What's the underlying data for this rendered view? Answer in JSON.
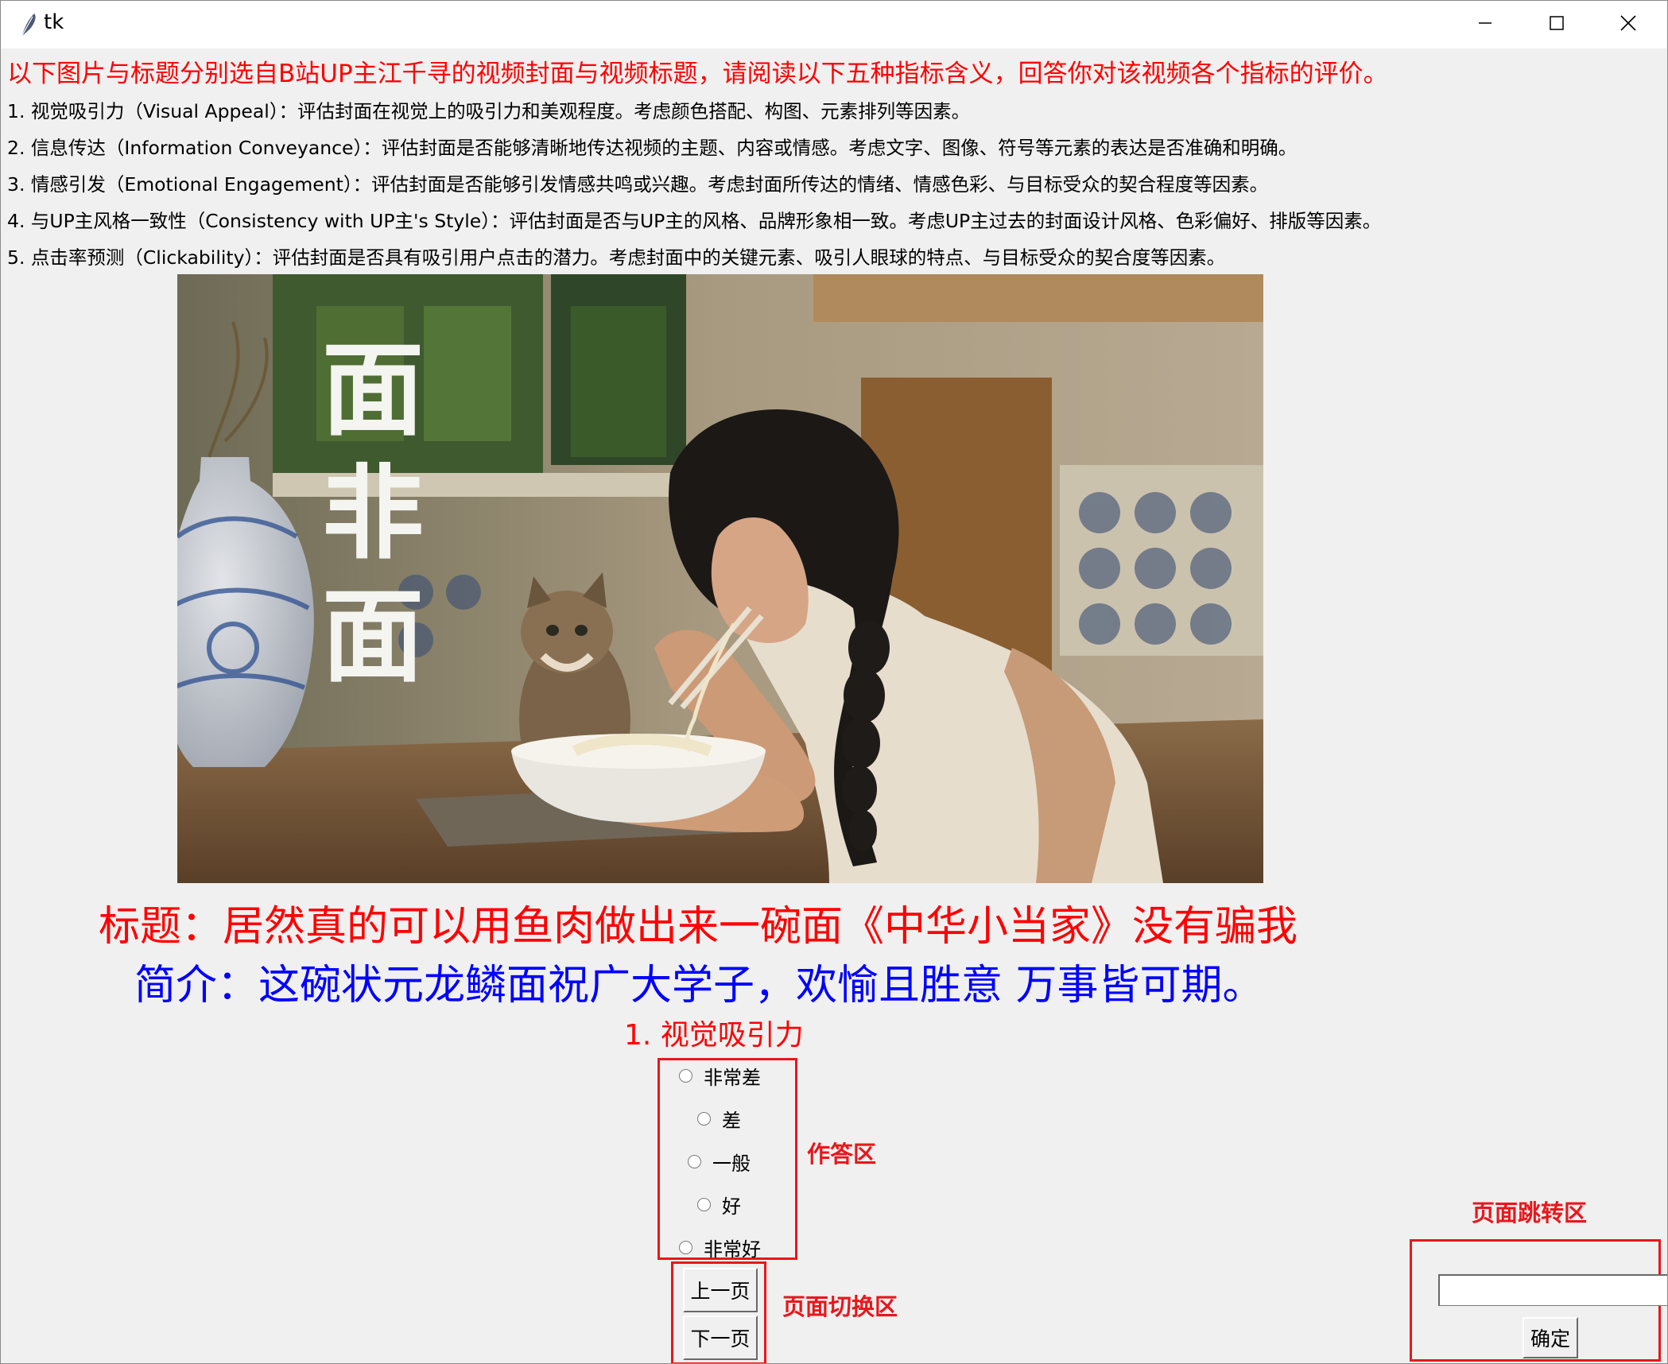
{
  "window": {
    "title": "tk"
  },
  "instructions": {
    "intro": "以下图片与标题分别选自B站UP主江千寻的视频封面与视频标题，请阅读以下五种指标含义，回答你对该视频各个指标的评价。",
    "criteria": [
      "1. 视觉吸引力（Visual Appeal）：评估封面在视觉上的吸引力和美观程度。考虑颜色搭配、构图、元素排列等因素。",
      "2. 信息传达（Information Conveyance）：评估封面是否能够清晰地传达视频的主题、内容或情感。考虑文字、图像、符号等元素的表达是否准确和明确。",
      "3. 情感引发（Emotional Engagement）：评估封面是否能够引发情感共鸣或兴趣。考虑封面所传达的情绪、情感色彩、与目标受众的契合程度等因素。",
      "4. 与UP主风格一致性（Consistency with UP主's Style）：评估封面是否与UP主的风格、品牌形象相一致。考虑UP主过去的封面设计风格、色彩偏好、排版等因素。",
      "5. 点击率预测（Clickability）：评估封面是否具有吸引用户点击的潜力。考虑封面中的关键元素、吸引人眼球的特点、与目标受众的契合度等因素。"
    ]
  },
  "cover": {
    "overlay_chars": [
      "面",
      "非",
      "面"
    ]
  },
  "video": {
    "title": "标题：居然真的可以用鱼肉做出来一碗面《中华小当家》没有骗我",
    "description": "简介：这碗状元龙鳞面祝广大学子，欢愉且胜意 万事皆可期。"
  },
  "question": {
    "label": "1. 视觉吸引力",
    "options": [
      "非常差",
      "差",
      "一般",
      "好",
      "非常好"
    ]
  },
  "navigation": {
    "prev_label": "上一页",
    "next_label": "下一页",
    "jump_value": "",
    "confirm_label": "确定"
  },
  "annotations": {
    "answer_area": "作答区",
    "switch_area": "页面切换区",
    "jump_area": "页面跳转区"
  },
  "colors": {
    "intro_text": "#ff0000",
    "title_text": "#ff0000",
    "description_text": "#0000ff",
    "annotation_box": "#e8171b"
  }
}
